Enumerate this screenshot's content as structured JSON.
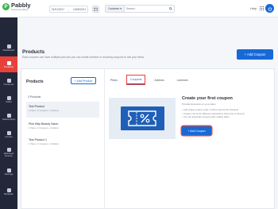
{
  "brand": {
    "name": "Pabbly",
    "tagline": "Subscription Billing",
    "logo_letter": "P"
  },
  "topbar": {
    "date_from": "01/01/2017",
    "date_to": "10/05/2021",
    "date_separator": "-",
    "search_scope": "Customer ▾",
    "search_placeholder": "Search...",
    "help_label": "Help",
    "accent_color": "#1769d6"
  },
  "sidebar": {
    "items": [
      {
        "label": "Dashboard",
        "icon": "dashboard-icon",
        "active": false
      },
      {
        "label": "Products",
        "icon": "products-icon",
        "active": true
      },
      {
        "label": "Customer",
        "icon": "customer-icon",
        "active": false
      },
      {
        "label": "Sales",
        "icon": "sales-icon",
        "active": false
      },
      {
        "label": "Subscription",
        "icon": "subscription-icon",
        "active": false
      },
      {
        "label": "Invoice",
        "icon": "invoice-icon",
        "active": false
      },
      {
        "label": "Webhook Events",
        "icon": "webhook-icon",
        "active": false
      },
      {
        "label": "Settings",
        "icon": "gear-icon",
        "active": false
      },
      {
        "label": "Multiplan",
        "icon": "multiplan-icon",
        "active": false
      }
    ],
    "active_color": "#e8413a"
  },
  "header": {
    "title": "Products",
    "subtitle": "Each coupons can have multiple plan and you can create onetime or recurring coupons to sell your items.",
    "add_coupon_label": "+ Add Coupon"
  },
  "products_panel": {
    "heading": "Products",
    "add_product_label": "+ Add Product",
    "count_label": "3 Products",
    "items": [
      {
        "name": "Test Product",
        "meta": "1 Plans • 0 Coupons • 0 Addons",
        "selected": true
      },
      {
        "name": "Pink Kitty Beauty Salon",
        "meta": "1 Plans • 0 Coupons • 0 Addons",
        "selected": false
      },
      {
        "name": "Test Product 1",
        "meta": "1 Plans • 0 Coupons • 0 Addons",
        "selected": false
      }
    ]
  },
  "tabs": [
    {
      "label": "Plans",
      "active": false
    },
    {
      "label": "Coupons",
      "active": true
    },
    {
      "label": "Addons",
      "active": false
    },
    {
      "label": "Licenses",
      "active": false
    }
  ],
  "coupon_empty": {
    "title": "Create your first coupon",
    "subtitle": "Provide discounts on your plans",
    "bullets": [
      "Add unique coupon code, it will be used at the checkout",
      "Coupon can be for different redemptions (One time or forever)",
      "You can associate coupons with multiple plans"
    ],
    "button_label": "+ Add Coupon"
  }
}
